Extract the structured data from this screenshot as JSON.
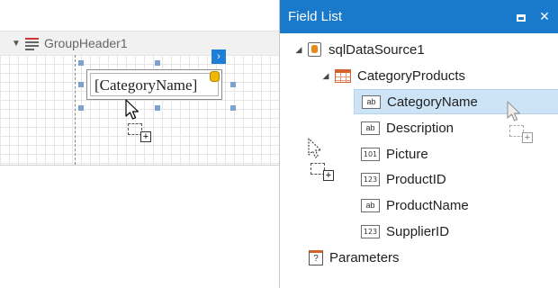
{
  "designer": {
    "band_label": "GroupHeader1",
    "label_text": "[CategoryName]",
    "smart_tag": "›"
  },
  "field_list": {
    "title": "Field List",
    "restore_icon": "restore-icon",
    "close_label": "✕",
    "datasource": {
      "name": "sqlDataSource1",
      "expanded": true
    },
    "table": {
      "name": "CategoryProducts",
      "expanded": true
    },
    "fields": [
      {
        "name": "CategoryName",
        "type_badge": "ab",
        "selected": true
      },
      {
        "name": "Description",
        "type_badge": "ab",
        "selected": false
      },
      {
        "name": "Picture",
        "type_badge": "101",
        "selected": false
      },
      {
        "name": "ProductID",
        "type_badge": "123",
        "selected": false
      },
      {
        "name": "ProductName",
        "type_badge": "ab",
        "selected": false
      },
      {
        "name": "SupplierID",
        "type_badge": "123",
        "selected": false
      }
    ],
    "parameters": {
      "name": "Parameters",
      "badge": "?"
    }
  },
  "colors": {
    "title_bar": "#1979ca",
    "selection": "#cde4f7",
    "smart_tag": "#1e7fd6"
  }
}
